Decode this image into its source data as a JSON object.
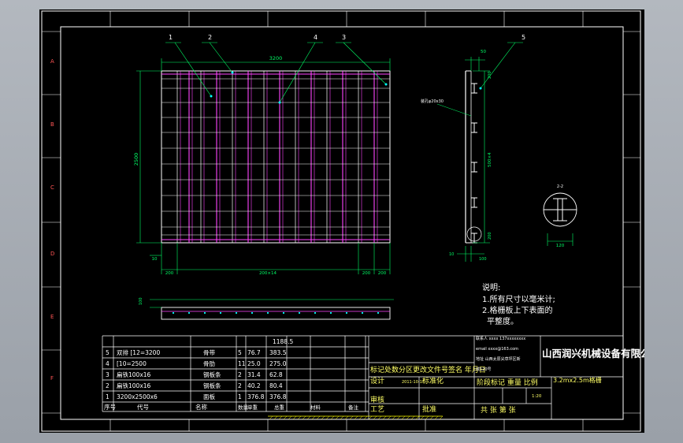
{
  "colors": {
    "frame": "#ffffff",
    "grating": "#ff44ff",
    "dimension": "#00ff66",
    "leader": "#00ffff",
    "title_text": "#ffff66",
    "hatch": "#ffff00",
    "background": "#000000"
  },
  "zone_letters": [
    "A",
    "B",
    "C",
    "D",
    "E",
    "F"
  ],
  "leaders": [
    "1",
    "2",
    "4",
    "3",
    "5"
  ],
  "dimensions": {
    "top_width": "3200",
    "left_height": "2500",
    "bottom_left_gap": "200",
    "bottom_pitch": "200×14",
    "bottom_right_a": "200",
    "bottom_right_b": "200",
    "small_left": "10",
    "side_top": "50",
    "side_pitch": "500×4",
    "side_mid_a": "200",
    "side_mid_b": "200",
    "side_bottom_a": "10",
    "side_bottom_b": "100",
    "detail_width": "120",
    "elevation_height": "100",
    "drain_hole_note": "装孔φ20x30"
  },
  "detail_label": "2-2",
  "notes": {
    "title": "说明:",
    "lines": [
      "1.所有尺寸以毫米计;",
      "2.格栅板上下表面的",
      "平整度。"
    ]
  },
  "bom": {
    "rows": [
      {
        "no": "5",
        "code": "双排 [12=3200",
        "name": "骨带",
        "qty": "5",
        "unit": "76.7",
        "total": "383.5"
      },
      {
        "no": "4",
        "code": "[10=2500",
        "name": "骨肋",
        "qty": "11",
        "unit": "25.0",
        "total": "275.0"
      },
      {
        "no": "3",
        "code": "扁铁100x16",
        "name": "钢板条",
        "qty": "2",
        "unit": "31.4",
        "total": "62.8"
      },
      {
        "no": "2",
        "code": "扁铁100x16",
        "name": "钢板条",
        "qty": "2",
        "unit": "40.2",
        "total": "80.4"
      },
      {
        "no": "1",
        "code": "3200x2500x6",
        "name": "面板",
        "qty": "1",
        "unit": "376.8",
        "total": "376.8"
      }
    ],
    "sum": "1188.5",
    "header": {
      "no": "序号",
      "code": "代号",
      "name": "名称",
      "qty": "数量",
      "unit": "单重",
      "total": "总重",
      "material": "材料",
      "remark": "备注"
    }
  },
  "title_block": {
    "revision_row": "标记处数分区更改文件号签名 年月日",
    "design": "设计",
    "standard": "标准化",
    "check": "审核",
    "process": "工艺",
    "approve": "批准",
    "stage_row": "阶段标记 重量 比例",
    "scale": "1:20",
    "sheets": "共  张  第  张",
    "company": "山西润兴机械设备有限公司",
    "contact_1": "联系人 xxxx 137xxxxxxxx",
    "contact_2": "email xxxx@163.com",
    "contact_3": "地址 山西太原尖草坪区新",
    "contact_4": "城120号",
    "date_code": "2011-10-15",
    "drawing_title": "3.2mx2.5m格栅"
  }
}
